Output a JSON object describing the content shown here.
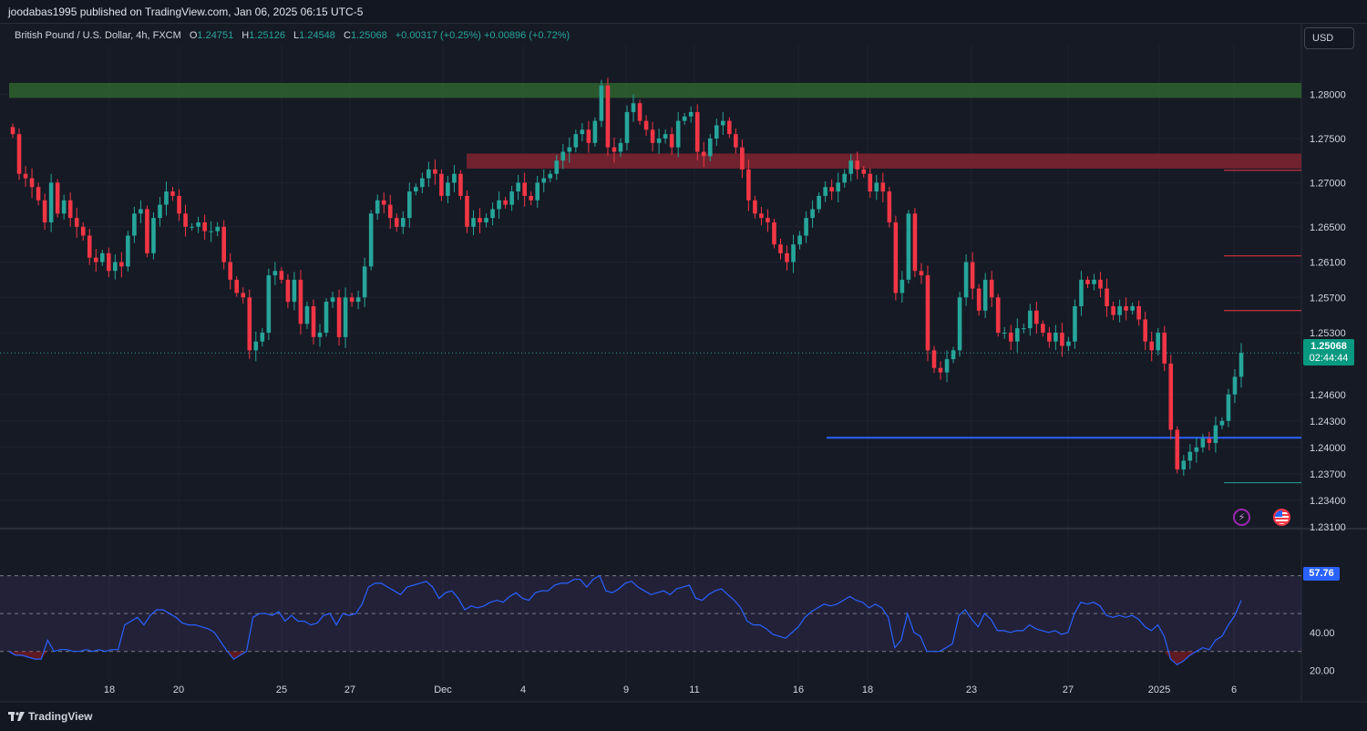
{
  "header": {
    "publisher_text": "joodabas1995 published on TradingView.com, Jan 06, 2025 06:15 UTC-5"
  },
  "legend": {
    "symbol": "British Pound / U.S. Dollar, 4h, FXCM",
    "o_label": "O",
    "o_value": "1.24751",
    "h_label": "H",
    "h_value": "1.25126",
    "l_label": "L",
    "l_value": "1.24548",
    "c_label": "C",
    "c_value": "1.25068",
    "change": "+0.00317 (+0.25%) +0.00896 (+0.72%)"
  },
  "currency_button": "USD",
  "last_price": {
    "price": "1.25068",
    "countdown": "02:44:44"
  },
  "rsi_value": "57.76",
  "footer": {
    "brand": "TradingView"
  },
  "icons": [
    "bolt-icon",
    "us-flag-icon",
    "tradingview-logo-icon"
  ],
  "colors": {
    "background": "#161a25",
    "up": "#26a69a",
    "down": "#f23645",
    "rsi_line": "#2962ff",
    "support_line": "#2962ff",
    "resistance_zone_top": "#2e5e2f",
    "resistance_zone_mid": "#7a2430"
  },
  "chart_data": [
    {
      "type": "candlestick",
      "title": "British Pound / U.S. Dollar, 4h, FXCM",
      "y_ticks": [
        "1.28000",
        "1.27500",
        "1.27000",
        "1.26500",
        "1.26100",
        "1.25700",
        "1.25300",
        "1.24600",
        "1.24300",
        "1.24000",
        "1.23700",
        "1.23400",
        "1.23100"
      ],
      "x_ticks": [
        "18",
        "20",
        "25",
        "27",
        "Dec",
        "4",
        "9",
        "11",
        "16",
        "18",
        "23",
        "27",
        "2025",
        "6"
      ],
      "ylim": [
        1.231,
        1.2845
      ],
      "grid": true,
      "zones": [
        {
          "name": "green zone",
          "from": 1.2796,
          "to": 1.2813,
          "color": "#2e5e2f"
        },
        {
          "name": "red zone",
          "from": 1.2716,
          "to": 1.2733,
          "color": "#7a2430"
        }
      ],
      "lines": [
        {
          "name": "blue level",
          "y": 1.2411,
          "color": "#2962ff"
        },
        {
          "name": "level 1",
          "y": 1.2714,
          "color": "#f23645"
        },
        {
          "name": "level 2",
          "y": 1.2617,
          "color": "#f23645"
        },
        {
          "name": "level 3",
          "y": 1.2555,
          "color": "#f23645"
        },
        {
          "name": "level 4",
          "y": 1.236,
          "color": "#26a69a"
        }
      ],
      "closes": [
        1.2755,
        1.271,
        1.2705,
        1.2695,
        1.268,
        1.2655,
        1.27,
        1.2665,
        1.268,
        1.266,
        1.265,
        1.264,
        1.2615,
        1.261,
        1.262,
        1.26,
        1.261,
        1.2605,
        1.264,
        1.2665,
        1.267,
        1.262,
        1.266,
        1.2675,
        1.269,
        1.2685,
        1.2665,
        1.265,
        1.265,
        1.2655,
        1.2645,
        1.2645,
        1.265,
        1.261,
        1.259,
        1.2575,
        1.257,
        1.251,
        1.252,
        1.253,
        1.2595,
        1.26,
        1.259,
        1.2565,
        1.259,
        1.254,
        1.256,
        1.2525,
        1.253,
        1.2565,
        1.257,
        1.2525,
        1.257,
        1.2565,
        1.257,
        1.2605,
        1.2665,
        1.268,
        1.2675,
        1.266,
        1.265,
        1.266,
        1.269,
        1.2695,
        1.2705,
        1.2715,
        1.271,
        1.2685,
        1.27,
        1.271,
        1.2685,
        1.265,
        1.266,
        1.2655,
        1.266,
        1.267,
        1.268,
        1.2675,
        1.269,
        1.27,
        1.2685,
        1.268,
        1.27,
        1.2705,
        1.271,
        1.2725,
        1.2735,
        1.274,
        1.2755,
        1.276,
        1.2745,
        1.277,
        1.281,
        1.274,
        1.2735,
        1.2745,
        1.278,
        1.279,
        1.277,
        1.276,
        1.2745,
        1.275,
        1.2755,
        1.274,
        1.277,
        1.2775,
        1.278,
        1.2735,
        1.273,
        1.275,
        1.2765,
        1.277,
        1.2755,
        1.274,
        1.2715,
        1.268,
        1.2665,
        1.266,
        1.2655,
        1.263,
        1.262,
        1.261,
        1.263,
        1.264,
        1.266,
        1.267,
        1.2685,
        1.2695,
        1.269,
        1.27,
        1.271,
        1.2725,
        1.2715,
        1.271,
        1.269,
        1.27,
        1.269,
        1.2655,
        1.2575,
        1.259,
        1.2665,
        1.26,
        1.2595,
        1.251,
        1.249,
        1.2485,
        1.25,
        1.251,
        1.257,
        1.261,
        1.258,
        1.2555,
        1.259,
        1.257,
        1.253,
        1.253,
        1.252,
        1.2535,
        1.2535,
        1.2555,
        1.254,
        1.253,
        1.252,
        1.253,
        1.2515,
        1.252,
        1.256,
        1.259,
        1.2585,
        1.259,
        1.258,
        1.256,
        1.255,
        1.256,
        1.2555,
        1.256,
        1.2545,
        1.252,
        1.251,
        1.253,
        1.2495,
        1.242,
        1.2375,
        1.2385,
        1.2395,
        1.24,
        1.241,
        1.2405,
        1.2425,
        1.243,
        1.246,
        1.248,
        1.2507
      ]
    },
    {
      "type": "line",
      "name": "RSI",
      "y_ticks": [
        "40.00",
        "20.00"
      ],
      "ylim": [
        14,
        90
      ],
      "levels": [
        70,
        50,
        30
      ],
      "values": [
        30,
        28,
        28,
        27,
        26,
        26,
        36,
        30,
        31,
        31,
        30,
        30,
        31,
        30,
        31,
        30,
        31,
        31,
        44,
        46,
        48,
        44,
        49,
        52,
        52,
        50,
        48,
        45,
        44,
        44,
        43,
        42,
        40,
        35,
        30,
        26,
        28,
        30,
        48,
        50,
        50,
        49,
        51,
        46,
        49,
        46,
        46,
        44,
        45,
        49,
        50,
        44,
        50,
        49,
        50,
        55,
        64,
        66,
        66,
        64,
        62,
        60,
        64,
        65,
        66,
        67,
        64,
        58,
        61,
        62,
        58,
        52,
        54,
        53,
        54,
        56,
        57,
        56,
        59,
        61,
        58,
        57,
        61,
        62,
        62,
        65,
        66,
        66,
        68,
        68,
        64,
        68,
        70,
        62,
        61,
        63,
        66,
        67,
        64,
        62,
        60,
        61,
        62,
        60,
        63,
        64,
        65,
        58,
        57,
        60,
        62,
        63,
        60,
        57,
        53,
        46,
        44,
        44,
        42,
        39,
        38,
        37,
        40,
        43,
        48,
        51,
        53,
        55,
        54,
        55,
        57,
        59,
        57,
        56,
        53,
        55,
        53,
        48,
        32,
        36,
        50,
        40,
        38,
        30,
        30,
        30,
        32,
        34,
        49,
        52,
        47,
        43,
        50,
        47,
        41,
        41,
        40,
        41,
        41,
        44,
        42,
        41,
        40,
        41,
        39,
        40,
        50,
        56,
        55,
        56,
        54,
        49,
        48,
        49,
        48,
        49,
        47,
        43,
        41,
        44,
        38,
        26,
        23,
        25,
        28,
        30,
        32,
        31,
        36,
        38,
        44,
        49,
        57
      ]
    }
  ]
}
